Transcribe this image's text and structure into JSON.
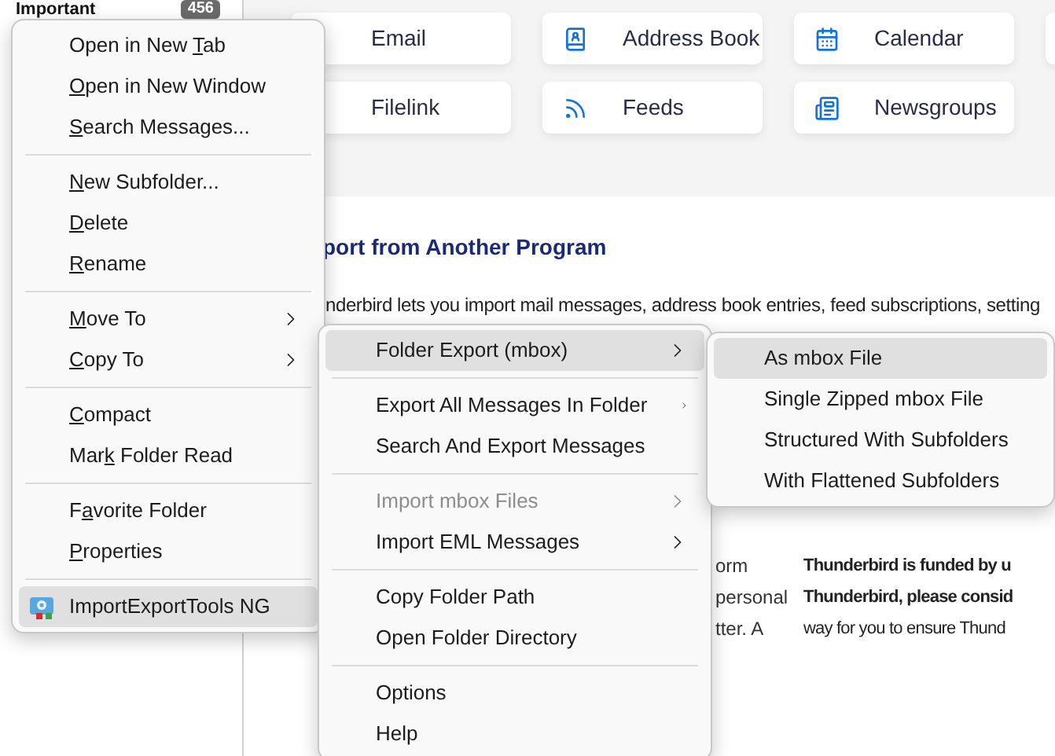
{
  "folder_pane": {
    "folder": "Important",
    "count": "456"
  },
  "tiles": [
    {
      "label": "Email"
    },
    {
      "label": "Address Book",
      "kind": "address-book"
    },
    {
      "label": "Calendar",
      "kind": "calendar"
    },
    {
      "label": "Filelink"
    },
    {
      "label": "Feeds",
      "kind": "feeds"
    },
    {
      "label": "Newsgroups",
      "kind": "newsgroups"
    }
  ],
  "content": {
    "heading": "port from Another Program",
    "intro": "nderbird lets you import mail messages, address book entries, feed subscriptions, setting",
    "left_fragments": [
      "orm",
      "personal",
      "tter. A"
    ],
    "funding_lines": [
      {
        "text": "Thunderbird is funded by u",
        "bold": true
      },
      {
        "text": "Thunderbird, please consid",
        "bold": true
      },
      {
        "text": "way for you to ensure Thund",
        "bold": false
      }
    ]
  },
  "menus": [
    {
      "items": [
        {
          "kind": "item",
          "parts": [
            {
              "text": "Open in New ",
              "underline": false
            },
            {
              "text": "T",
              "underline": true
            },
            {
              "text": "ab",
              "underline": false
            }
          ],
          "submenu": false,
          "selected": false,
          "disabled": false
        },
        {
          "kind": "item",
          "parts": [
            {
              "text": "O",
              "underline": true
            },
            {
              "text": "pen in New Window",
              "underline": false
            }
          ],
          "submenu": false,
          "selected": false,
          "disabled": false
        },
        {
          "kind": "item",
          "parts": [
            {
              "text": "S",
              "underline": true
            },
            {
              "text": "earch Messages...",
              "underline": false
            }
          ],
          "submenu": false,
          "selected": false,
          "disabled": false
        },
        {
          "kind": "separator"
        },
        {
          "kind": "item",
          "parts": [
            {
              "text": "N",
              "underline": true
            },
            {
              "text": "ew Subfolder...",
              "underline": false
            }
          ],
          "submenu": false,
          "selected": false,
          "disabled": false
        },
        {
          "kind": "item",
          "parts": [
            {
              "text": "D",
              "underline": true
            },
            {
              "text": "elete",
              "underline": false
            }
          ],
          "submenu": false,
          "selected": false,
          "disabled": false
        },
        {
          "kind": "item",
          "parts": [
            {
              "text": "R",
              "underline": true
            },
            {
              "text": "ename",
              "underline": false
            }
          ],
          "submenu": false,
          "selected": false,
          "disabled": false
        },
        {
          "kind": "separator"
        },
        {
          "kind": "item",
          "parts": [
            {
              "text": "M",
              "underline": true
            },
            {
              "text": "ove To",
              "underline": false
            }
          ],
          "submenu": true,
          "selected": false,
          "disabled": false
        },
        {
          "kind": "item",
          "parts": [
            {
              "text": "C",
              "underline": true
            },
            {
              "text": "opy To",
              "underline": false
            }
          ],
          "submenu": true,
          "selected": false,
          "disabled": false
        },
        {
          "kind": "separator"
        },
        {
          "kind": "item",
          "parts": [
            {
              "text": "C",
              "underline": true
            },
            {
              "text": "ompact",
              "underline": false
            }
          ],
          "submenu": false,
          "selected": false,
          "disabled": false
        },
        {
          "kind": "item",
          "parts": [
            {
              "text": "Mar",
              "underline": false
            },
            {
              "text": "k",
              "underline": true
            },
            {
              "text": " Folder Read",
              "underline": false
            }
          ],
          "submenu": false,
          "selected": false,
          "disabled": false
        },
        {
          "kind": "separator"
        },
        {
          "kind": "item",
          "parts": [
            {
              "text": "F",
              "underline": false
            },
            {
              "text": "a",
              "underline": true
            },
            {
              "text": "vorite Folder",
              "underline": false
            }
          ],
          "submenu": false,
          "selected": false,
          "disabled": false
        },
        {
          "kind": "item",
          "parts": [
            {
              "text": "P",
              "underline": true
            },
            {
              "text": "roperties",
              "underline": false
            }
          ],
          "submenu": false,
          "selected": false,
          "disabled": false
        },
        {
          "kind": "separator"
        },
        {
          "kind": "addon-item",
          "parts": [
            {
              "text": "ImportExportTools NG",
              "underline": false
            }
          ],
          "submenu": true,
          "selected": true,
          "disabled": false
        }
      ]
    },
    {
      "items": [
        {
          "kind": "item",
          "parts": [
            {
              "text": "Folder Export (mbox)",
              "underline": false
            }
          ],
          "submenu": true,
          "selected": true,
          "disabled": false
        },
        {
          "kind": "separator"
        },
        {
          "kind": "item",
          "parts": [
            {
              "text": "Export All Messages In Folder",
              "underline": false
            }
          ],
          "submenu": true,
          "selected": false,
          "disabled": false
        },
        {
          "kind": "item",
          "parts": [
            {
              "text": "Search And Export Messages",
              "underline": false
            }
          ],
          "submenu": false,
          "selected": false,
          "disabled": false
        },
        {
          "kind": "separator"
        },
        {
          "kind": "item",
          "parts": [
            {
              "text": "Import mbox Files",
              "underline": false
            }
          ],
          "submenu": true,
          "selected": false,
          "disabled": true
        },
        {
          "kind": "item",
          "parts": [
            {
              "text": "Import EML Messages",
              "underline": false
            }
          ],
          "submenu": true,
          "selected": false,
          "disabled": false
        },
        {
          "kind": "separator"
        },
        {
          "kind": "item",
          "parts": [
            {
              "text": "Copy Folder Path",
              "underline": false
            }
          ],
          "submenu": false,
          "selected": false,
          "disabled": false
        },
        {
          "kind": "item",
          "parts": [
            {
              "text": "Open Folder Directory",
              "underline": false
            }
          ],
          "submenu": false,
          "selected": false,
          "disabled": false
        },
        {
          "kind": "separator"
        },
        {
          "kind": "item",
          "parts": [
            {
              "text": "Options",
              "underline": false
            }
          ],
          "submenu": false,
          "selected": false,
          "disabled": false
        },
        {
          "kind": "item",
          "parts": [
            {
              "text": "Help",
              "underline": false
            }
          ],
          "submenu": false,
          "selected": false,
          "disabled": false
        }
      ]
    },
    {
      "items": [
        {
          "kind": "item",
          "parts": [
            {
              "text": "As mbox File",
              "underline": false
            }
          ],
          "selected": true,
          "disabled": false
        },
        {
          "kind": "item",
          "parts": [
            {
              "text": "Single Zipped mbox File",
              "underline": false
            }
          ],
          "selected": false,
          "disabled": false
        },
        {
          "kind": "item",
          "parts": [
            {
              "text": "Structured With Subfolders",
              "underline": false
            }
          ],
          "selected": false,
          "disabled": false
        },
        {
          "kind": "item",
          "parts": [
            {
              "text": "With Flattened Subfolders",
              "underline": false
            }
          ],
          "selected": false,
          "disabled": false
        }
      ]
    }
  ]
}
